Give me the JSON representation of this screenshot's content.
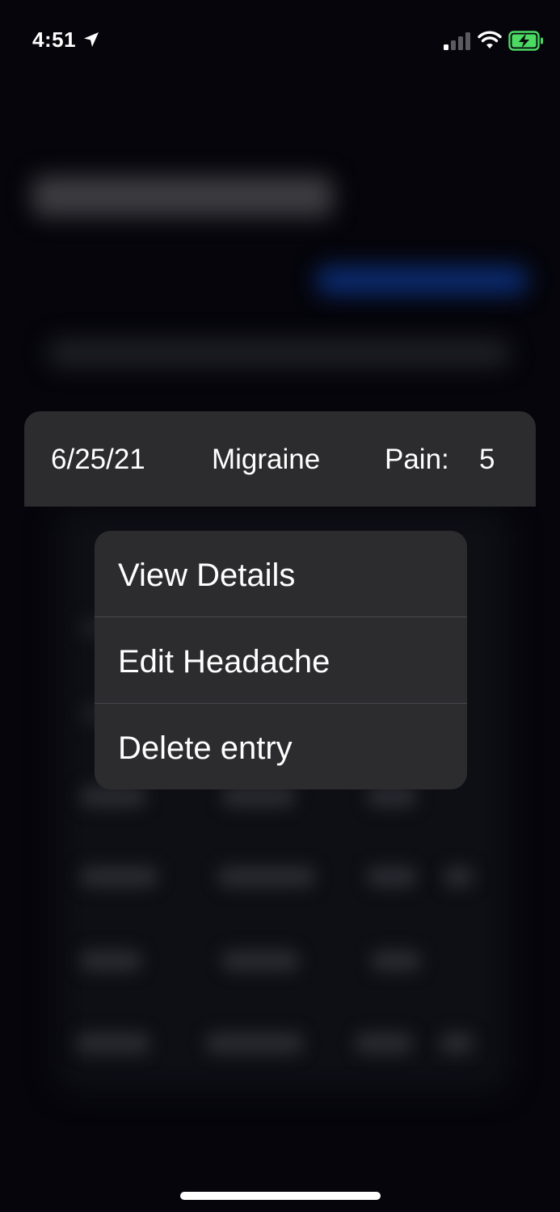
{
  "status_bar": {
    "time": "4:51",
    "icons": [
      "location-arrow-icon",
      "cellular-signal-icon",
      "wifi-icon",
      "battery-charging-icon"
    ],
    "battery_color": "#4cd964"
  },
  "entry_preview": {
    "date": "6/25/21",
    "type": "Migraine",
    "pain_label": "Pain:",
    "pain_value": "5"
  },
  "context_menu": {
    "items": [
      {
        "label": "View Details"
      },
      {
        "label": "Edit Headache"
      },
      {
        "label": "Delete entry"
      }
    ]
  },
  "colors": {
    "background": "#05050b",
    "surface": "#2c2c2e",
    "divider": "#48484c",
    "text": "#ffffff",
    "accent_blurred": "#0b2c74"
  }
}
